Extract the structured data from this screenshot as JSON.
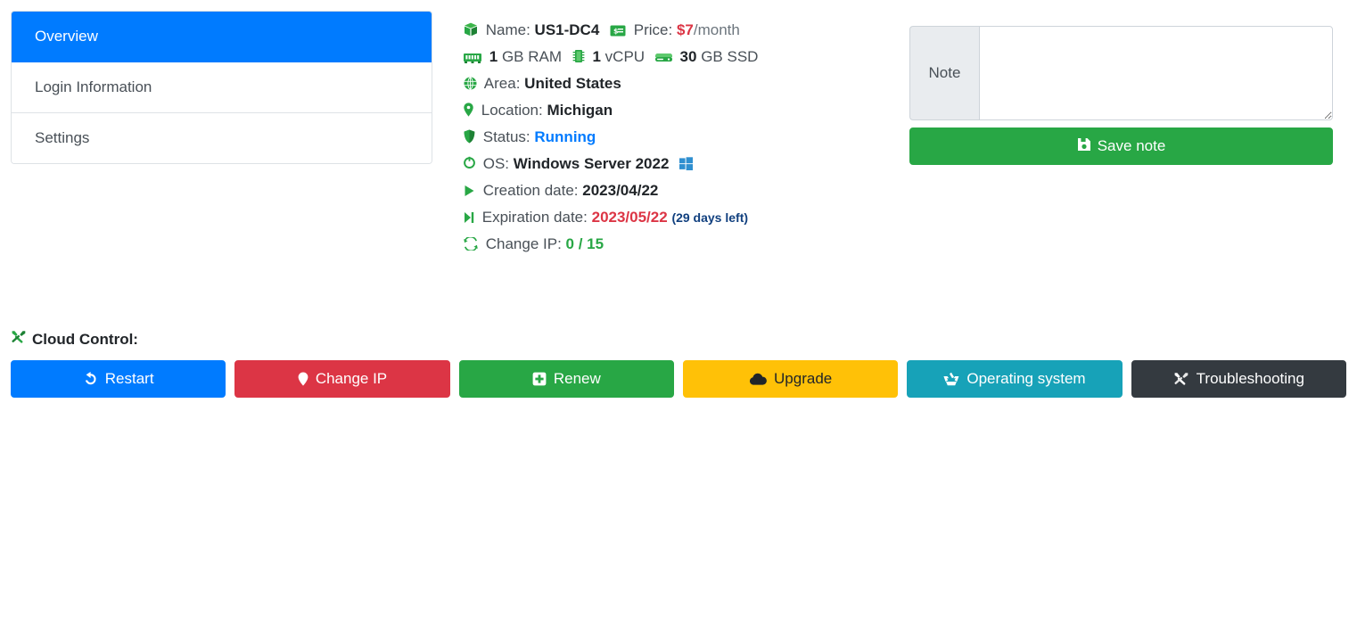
{
  "colors": {
    "primary": "#007bff",
    "danger": "#dc3545",
    "success": "#28a745",
    "warning": "#ffc107",
    "info": "#17a2b8",
    "dark": "#343a40",
    "status_running": "#007bff",
    "price": "#dc3545",
    "expiration_date": "#dc3545",
    "days_left": "#11407f"
  },
  "sidebar": {
    "items": [
      {
        "label": "Overview",
        "active": true,
        "icon": "none"
      },
      {
        "label": "Login Information",
        "active": false,
        "icon": "none"
      },
      {
        "label": "Settings",
        "active": false,
        "icon": "none"
      }
    ]
  },
  "specs": {
    "name": {
      "icon": "box-icon",
      "label": "Name:",
      "value": "US1-DC4",
      "price_icon": "money-bill-icon",
      "price_label": "Price:",
      "price_value": "$7",
      "price_unit": "/month"
    },
    "hardware": {
      "ram_icon": "memory-icon",
      "ram_value": "1",
      "ram_unit": "GB RAM",
      "cpu_icon": "microchip-icon",
      "cpu_value": "1",
      "cpu_unit": "vCPU",
      "disk_icon": "hdd-icon",
      "disk_value": "30",
      "disk_unit": "GB SSD"
    },
    "area": {
      "icon": "globe-icon",
      "label": "Area:",
      "value": "United States"
    },
    "location": {
      "icon": "map-marker-icon",
      "label": "Location:",
      "value": "Michigan"
    },
    "status": {
      "icon": "shield-icon",
      "label": "Status:",
      "value": "Running"
    },
    "os": {
      "icon": "power-circle-icon",
      "label": "OS:",
      "value": "Windows Server 2022",
      "os_logo_icon": "windows-icon"
    },
    "creation": {
      "icon": "play-icon",
      "label": "Creation date:",
      "value": "2023/04/22"
    },
    "expiration": {
      "icon": "step-forward-icon",
      "label": "Expiration date:",
      "value": "2023/05/22",
      "days_left": "(29 days left)"
    },
    "change_ip": {
      "icon": "sync-icon",
      "label": "Change IP:",
      "value": "0 / 15"
    }
  },
  "note": {
    "addon_label": "Note",
    "value": "",
    "placeholder": "",
    "save_icon": "save-icon",
    "save_label": "Save note"
  },
  "cloud_control": {
    "title_icon": "tools-icon",
    "title": "Cloud Control:",
    "buttons": [
      {
        "label": "Restart",
        "icon": "undo-icon",
        "style": "primary"
      },
      {
        "label": "Change IP",
        "icon": "map-marker-icon",
        "style": "danger"
      },
      {
        "label": "Renew",
        "icon": "plus-square-icon",
        "style": "success"
      },
      {
        "label": "Upgrade",
        "icon": "cloud-upload-icon",
        "style": "warning"
      },
      {
        "label": "Operating system",
        "icon": "recycle-icon",
        "style": "info"
      },
      {
        "label": "Troubleshooting",
        "icon": "tools-icon",
        "style": "dark"
      }
    ]
  }
}
